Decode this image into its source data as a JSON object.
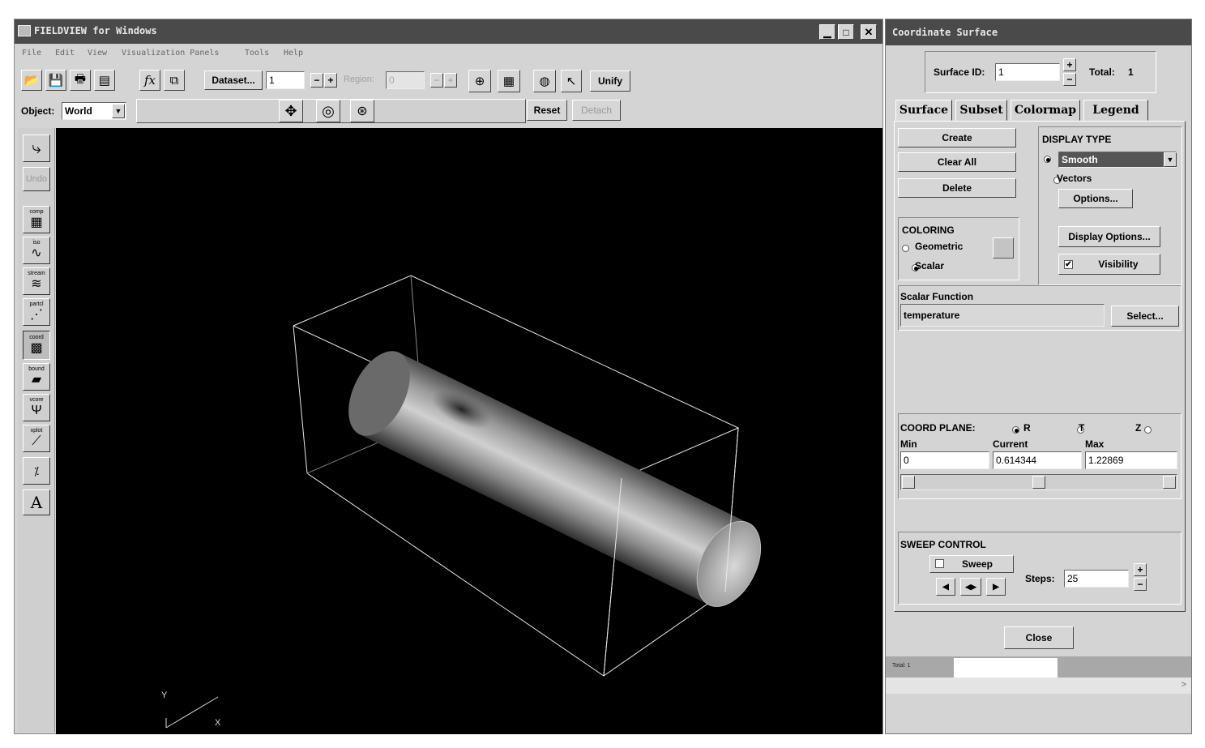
{
  "main_window": {
    "title": "FIELDVIEW for Windows",
    "menu": [
      "File",
      "Edit",
      "View",
      "Visualization Panels",
      "Tools",
      "Help"
    ],
    "toolbar": {
      "dataset_label": "Dataset...",
      "dataset_value": "1",
      "region_label": "Region:",
      "region_value": "0",
      "unify_label": "Unify"
    },
    "object_bar": {
      "object_label": "Object:",
      "object_value": "World",
      "reset_label": "Reset",
      "detach_label": "Detach"
    },
    "sidebar": {
      "undo_label": "Undo",
      "tools": [
        "comp",
        "iso",
        "stream",
        "partcl",
        "coord",
        "bound",
        "vcore",
        "xplot",
        "",
        ""
      ],
      "text_tool": "A"
    },
    "viewport": {
      "axis_y": "Y",
      "axis_x": "X"
    }
  },
  "panel": {
    "title": "Coordinate Surface",
    "surface_id_label": "Surface ID:",
    "surface_id_value": "1",
    "total_label": "Total:",
    "total_value": "1",
    "tabs": [
      "Surface",
      "Subset",
      "Colormap",
      "Legend"
    ],
    "buttons": {
      "create": "Create",
      "clear_all": "Clear All",
      "delete": "Delete"
    },
    "display_type": {
      "heading": "DISPLAY TYPE",
      "selected": "Smooth",
      "vectors_label": "Vectors",
      "options_label": "Options..."
    },
    "coloring": {
      "heading": "COLORING",
      "geometric_label": "Geometric",
      "scalar_label": "Scalar"
    },
    "display_options_label": "Display Options...",
    "visibility_label": "Visibility",
    "scalar_function": {
      "heading": "Scalar Function",
      "value": "temperature",
      "select_label": "Select..."
    },
    "coord_plane": {
      "heading": "COORD PLANE:",
      "r_label": "R",
      "t_label": "T",
      "z_label": "Z",
      "min_label": "Min",
      "current_label": "Current",
      "max_label": "Max",
      "min_value": "0",
      "current_value": "0.614344",
      "max_value": "1.22869",
      "slider_fraction": 0.5
    },
    "sweep": {
      "heading": "SWEEP CONTROL",
      "sweep_label": "Sweep",
      "steps_label": "Steps:",
      "steps_value": "25"
    },
    "close_label": "Close",
    "status_total": "Total: 1"
  },
  "colors": {
    "title_bar": "#4a4a4a",
    "panel_bg": "#d4d4d4",
    "viewport_bg": "#000000",
    "selected_bg": "#555555"
  }
}
